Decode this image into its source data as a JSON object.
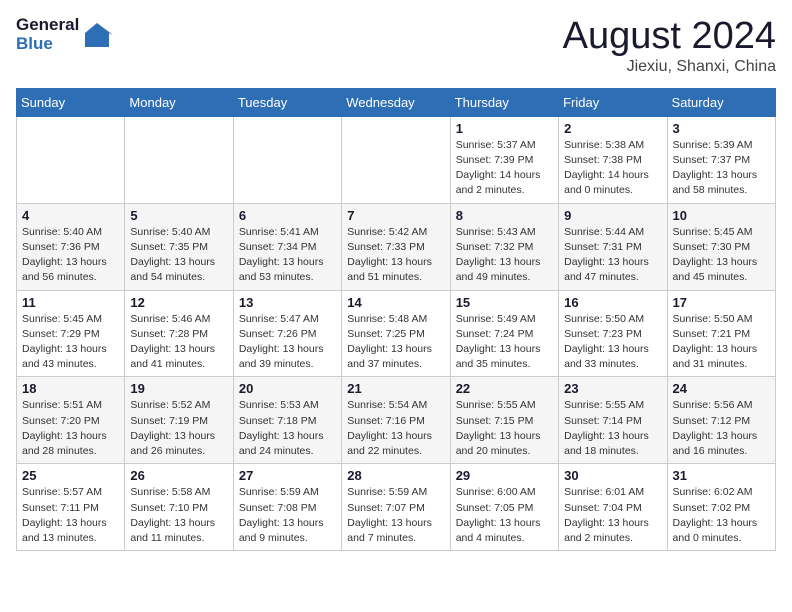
{
  "header": {
    "logo_line1": "General",
    "logo_line2": "Blue",
    "month": "August 2024",
    "location": "Jiexiu, Shanxi, China"
  },
  "days_of_week": [
    "Sunday",
    "Monday",
    "Tuesday",
    "Wednesday",
    "Thursday",
    "Friday",
    "Saturday"
  ],
  "weeks": [
    [
      {
        "day": "",
        "info": ""
      },
      {
        "day": "",
        "info": ""
      },
      {
        "day": "",
        "info": ""
      },
      {
        "day": "",
        "info": ""
      },
      {
        "day": "1",
        "info": "Sunrise: 5:37 AM\nSunset: 7:39 PM\nDaylight: 14 hours\nand 2 minutes."
      },
      {
        "day": "2",
        "info": "Sunrise: 5:38 AM\nSunset: 7:38 PM\nDaylight: 14 hours\nand 0 minutes."
      },
      {
        "day": "3",
        "info": "Sunrise: 5:39 AM\nSunset: 7:37 PM\nDaylight: 13 hours\nand 58 minutes."
      }
    ],
    [
      {
        "day": "4",
        "info": "Sunrise: 5:40 AM\nSunset: 7:36 PM\nDaylight: 13 hours\nand 56 minutes."
      },
      {
        "day": "5",
        "info": "Sunrise: 5:40 AM\nSunset: 7:35 PM\nDaylight: 13 hours\nand 54 minutes."
      },
      {
        "day": "6",
        "info": "Sunrise: 5:41 AM\nSunset: 7:34 PM\nDaylight: 13 hours\nand 53 minutes."
      },
      {
        "day": "7",
        "info": "Sunrise: 5:42 AM\nSunset: 7:33 PM\nDaylight: 13 hours\nand 51 minutes."
      },
      {
        "day": "8",
        "info": "Sunrise: 5:43 AM\nSunset: 7:32 PM\nDaylight: 13 hours\nand 49 minutes."
      },
      {
        "day": "9",
        "info": "Sunrise: 5:44 AM\nSunset: 7:31 PM\nDaylight: 13 hours\nand 47 minutes."
      },
      {
        "day": "10",
        "info": "Sunrise: 5:45 AM\nSunset: 7:30 PM\nDaylight: 13 hours\nand 45 minutes."
      }
    ],
    [
      {
        "day": "11",
        "info": "Sunrise: 5:45 AM\nSunset: 7:29 PM\nDaylight: 13 hours\nand 43 minutes."
      },
      {
        "day": "12",
        "info": "Sunrise: 5:46 AM\nSunset: 7:28 PM\nDaylight: 13 hours\nand 41 minutes."
      },
      {
        "day": "13",
        "info": "Sunrise: 5:47 AM\nSunset: 7:26 PM\nDaylight: 13 hours\nand 39 minutes."
      },
      {
        "day": "14",
        "info": "Sunrise: 5:48 AM\nSunset: 7:25 PM\nDaylight: 13 hours\nand 37 minutes."
      },
      {
        "day": "15",
        "info": "Sunrise: 5:49 AM\nSunset: 7:24 PM\nDaylight: 13 hours\nand 35 minutes."
      },
      {
        "day": "16",
        "info": "Sunrise: 5:50 AM\nSunset: 7:23 PM\nDaylight: 13 hours\nand 33 minutes."
      },
      {
        "day": "17",
        "info": "Sunrise: 5:50 AM\nSunset: 7:21 PM\nDaylight: 13 hours\nand 31 minutes."
      }
    ],
    [
      {
        "day": "18",
        "info": "Sunrise: 5:51 AM\nSunset: 7:20 PM\nDaylight: 13 hours\nand 28 minutes."
      },
      {
        "day": "19",
        "info": "Sunrise: 5:52 AM\nSunset: 7:19 PM\nDaylight: 13 hours\nand 26 minutes."
      },
      {
        "day": "20",
        "info": "Sunrise: 5:53 AM\nSunset: 7:18 PM\nDaylight: 13 hours\nand 24 minutes."
      },
      {
        "day": "21",
        "info": "Sunrise: 5:54 AM\nSunset: 7:16 PM\nDaylight: 13 hours\nand 22 minutes."
      },
      {
        "day": "22",
        "info": "Sunrise: 5:55 AM\nSunset: 7:15 PM\nDaylight: 13 hours\nand 20 minutes."
      },
      {
        "day": "23",
        "info": "Sunrise: 5:55 AM\nSunset: 7:14 PM\nDaylight: 13 hours\nand 18 minutes."
      },
      {
        "day": "24",
        "info": "Sunrise: 5:56 AM\nSunset: 7:12 PM\nDaylight: 13 hours\nand 16 minutes."
      }
    ],
    [
      {
        "day": "25",
        "info": "Sunrise: 5:57 AM\nSunset: 7:11 PM\nDaylight: 13 hours\nand 13 minutes."
      },
      {
        "day": "26",
        "info": "Sunrise: 5:58 AM\nSunset: 7:10 PM\nDaylight: 13 hours\nand 11 minutes."
      },
      {
        "day": "27",
        "info": "Sunrise: 5:59 AM\nSunset: 7:08 PM\nDaylight: 13 hours\nand 9 minutes."
      },
      {
        "day": "28",
        "info": "Sunrise: 5:59 AM\nSunset: 7:07 PM\nDaylight: 13 hours\nand 7 minutes."
      },
      {
        "day": "29",
        "info": "Sunrise: 6:00 AM\nSunset: 7:05 PM\nDaylight: 13 hours\nand 4 minutes."
      },
      {
        "day": "30",
        "info": "Sunrise: 6:01 AM\nSunset: 7:04 PM\nDaylight: 13 hours\nand 2 minutes."
      },
      {
        "day": "31",
        "info": "Sunrise: 6:02 AM\nSunset: 7:02 PM\nDaylight: 13 hours\nand 0 minutes."
      }
    ]
  ]
}
